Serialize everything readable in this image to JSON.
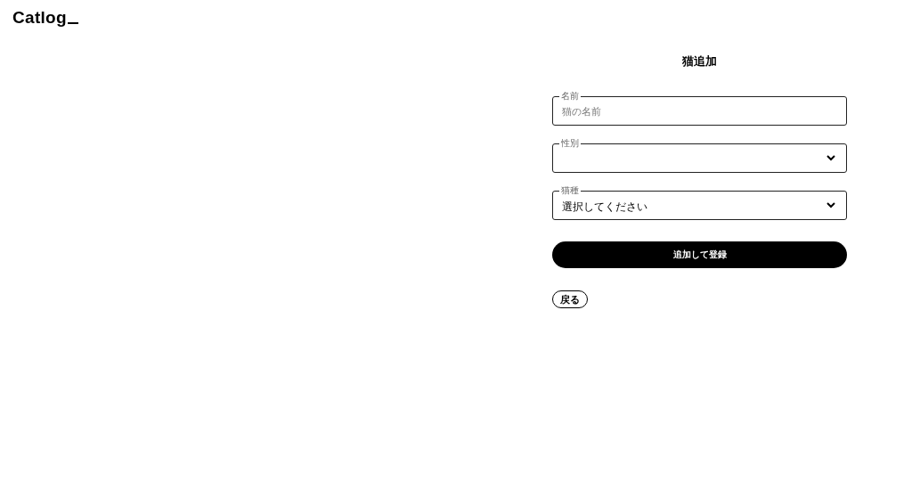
{
  "logo": {
    "text": "Catlog"
  },
  "form": {
    "title": "猫追加",
    "fields": [
      {
        "kind": "text",
        "label": "名前",
        "placeholder": "猫の名前"
      },
      {
        "kind": "select",
        "label": "性別"
      },
      {
        "kind": "select",
        "label": "猫種",
        "value": "選択してください"
      }
    ],
    "submit": "追加して登録",
    "back": "戻る"
  }
}
